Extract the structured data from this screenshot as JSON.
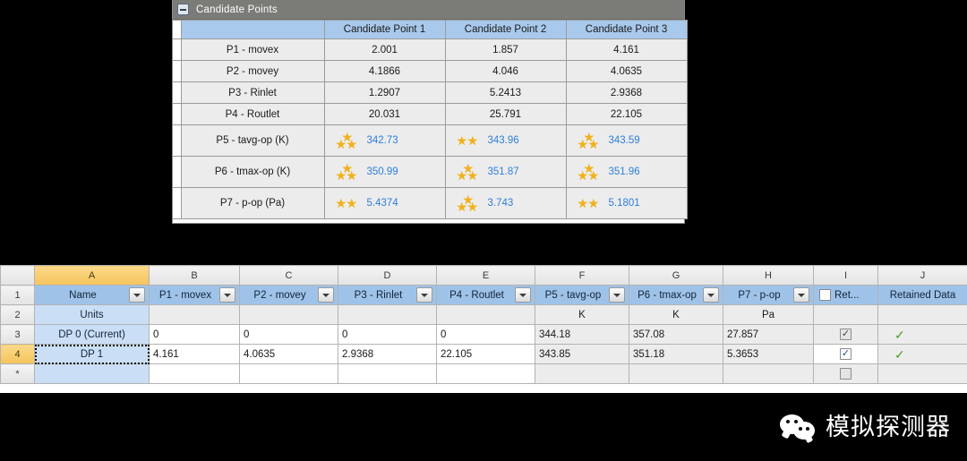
{
  "candidate_panel": {
    "title": "Candidate Points",
    "collapse_icon": "minus-box-icon",
    "columns": [
      "Candidate Point 1",
      "Candidate Point 2",
      "Candidate Point 3"
    ],
    "rows": [
      {
        "label": "P1 - movex",
        "type": "plain",
        "values": [
          "2.001",
          "1.857",
          "4.161"
        ]
      },
      {
        "label": "P2 - movey",
        "type": "plain",
        "values": [
          "4.1866",
          "4.046",
          "4.0635"
        ]
      },
      {
        "label": "P3 - Rinlet",
        "type": "plain",
        "values": [
          "1.2907",
          "5.2413",
          "2.9368"
        ]
      },
      {
        "label": "P4 - Routlet",
        "type": "plain",
        "values": [
          "20.031",
          "25.791",
          "22.105"
        ]
      },
      {
        "label": "P5 - tavg-op (K)",
        "type": "stars",
        "values": [
          "342.73",
          "343.96",
          "343.59"
        ],
        "stars": [
          3,
          2,
          3
        ]
      },
      {
        "label": "P6 - tmax-op (K)",
        "type": "stars",
        "values": [
          "350.99",
          "351.87",
          "351.96"
        ],
        "stars": [
          3,
          3,
          3
        ]
      },
      {
        "label": "P7 - p-op (Pa)",
        "type": "stars",
        "values": [
          "5.4374",
          "3.743",
          "5.1801"
        ],
        "stars": [
          2,
          3,
          2
        ]
      }
    ]
  },
  "grid": {
    "column_letters": [
      "A",
      "B",
      "C",
      "D",
      "E",
      "F",
      "G",
      "H",
      "I",
      "J"
    ],
    "selected_column": "A",
    "selected_row": "4",
    "row_numbers": [
      "1",
      "2",
      "3",
      "4",
      "*"
    ],
    "header_row": {
      "name": "Name",
      "p1": "P1 - movex",
      "p2": "P2 - movey",
      "p3": "P3 - Rinlet",
      "p4": "P4 - Routlet",
      "p5": "P5 - tavg-op",
      "p6": "P6 - tmax-op",
      "p7": "P7 - p-op",
      "retain_short": "Ret...",
      "retained_data": "Retained Data"
    },
    "units_row": {
      "label": "Units",
      "p1": "",
      "p2": "",
      "p3": "",
      "p4": "",
      "p5": "K",
      "p6": "K",
      "p7": "Pa"
    },
    "data_rows": [
      {
        "name": "DP 0 (Current)",
        "p1": "0",
        "p2": "0",
        "p3": "0",
        "p4": "0",
        "p5": "344.18",
        "p6": "357.08",
        "p7": "27.857",
        "retain_checked": true,
        "retained_data_mark": "✓"
      },
      {
        "name": "DP 1",
        "p1": "4.161",
        "p2": "4.0635",
        "p3": "2.9368",
        "p4": "22.105",
        "p5": "343.85",
        "p6": "351.18",
        "p7": "5.3653",
        "retain_checked": true,
        "retained_data_mark": "✓"
      }
    ],
    "new_row": {
      "name": "",
      "p1": "",
      "p2": "",
      "p3": "",
      "p4": "",
      "p5": "",
      "p6": "",
      "p7": "",
      "retain_checked": false,
      "retained_data_mark": ""
    }
  },
  "watermark": {
    "icon": "wechat-icon",
    "text": "模拟探测器"
  },
  "colors": {
    "header_blue": "#a9c9ec",
    "light_blue": "#cadff5",
    "selected_amber": "#f5c45c",
    "star_gold": "#f0b21c",
    "value_blue": "#2f7fd8",
    "check_green": "#4f9b26",
    "titlebar_grey": "#7b7b77"
  },
  "glyphs": {
    "star": "★",
    "check": "✓"
  }
}
